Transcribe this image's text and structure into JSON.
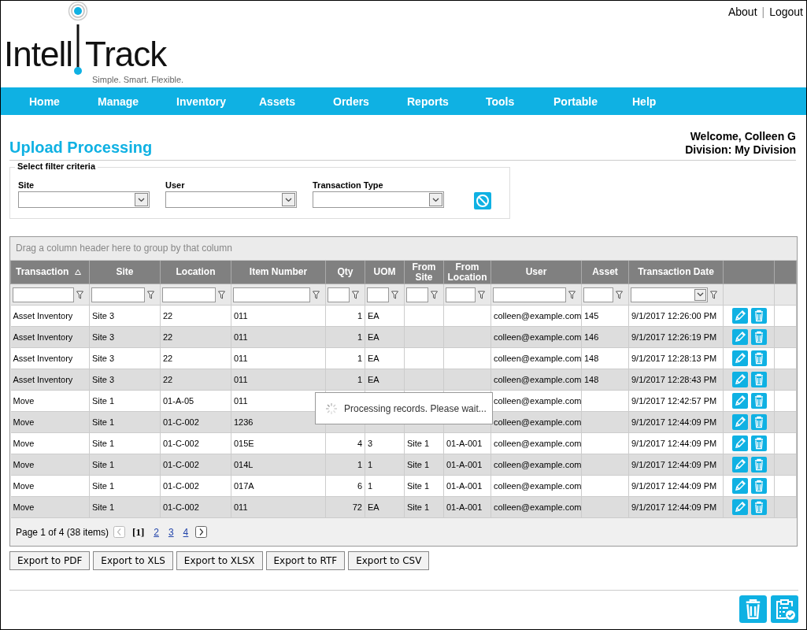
{
  "header_links": [
    "About",
    "Logout"
  ],
  "link_separator": "|",
  "logo": {
    "text_left": "Intell",
    "text_right": "Track",
    "tagline": "Simple. Smart. Flexible."
  },
  "nav": [
    "Home",
    "Manage",
    "Inventory",
    "Assets",
    "Orders",
    "Reports",
    "Tools",
    "Portable",
    "Help"
  ],
  "page_title": "Upload Processing",
  "welcome": "Welcome, Colleen G",
  "division": "Division: My Division",
  "filters": {
    "legend": "Select filter criteria",
    "fields": [
      {
        "label": "Site"
      },
      {
        "label": "User"
      },
      {
        "label": "Transaction Type"
      }
    ]
  },
  "grid": {
    "group_hint": "Drag a column header here to group by that column",
    "columns": [
      {
        "label": "Transaction",
        "sorted": true,
        "kind": "text"
      },
      {
        "label": "Site",
        "sorted": false,
        "kind": "text"
      },
      {
        "label": "Location",
        "sorted": false,
        "kind": "text"
      },
      {
        "label": "Item Number",
        "sorted": false,
        "kind": "text"
      },
      {
        "label": "Qty",
        "sorted": false,
        "kind": "text"
      },
      {
        "label": "UOM",
        "sorted": false,
        "kind": "text"
      },
      {
        "label": "From Site",
        "sorted": false,
        "kind": "text"
      },
      {
        "label": "From Location",
        "sorted": false,
        "kind": "text"
      },
      {
        "label": "User",
        "sorted": false,
        "kind": "text"
      },
      {
        "label": "Asset",
        "sorted": false,
        "kind": "text"
      },
      {
        "label": "Transaction Date",
        "sorted": false,
        "kind": "dropdown"
      }
    ],
    "rows": [
      {
        "cells": [
          "Asset Inventory",
          "Site 3",
          "22",
          "011",
          "1",
          "EA",
          null,
          null,
          "colleen@example.com",
          "145",
          "9/1/2017 12:26:00 PM"
        ]
      },
      {
        "cells": [
          "Asset Inventory",
          "Site 3",
          "22",
          "011",
          "1",
          "EA",
          null,
          null,
          "colleen@example.com",
          "146",
          "9/1/2017 12:26:19 PM"
        ]
      },
      {
        "cells": [
          "Asset Inventory",
          "Site 3",
          "22",
          "011",
          "1",
          "EA",
          null,
          null,
          "colleen@example.com",
          "148",
          "9/1/2017 12:28:13 PM"
        ]
      },
      {
        "cells": [
          "Asset Inventory",
          "Site 3",
          "22",
          "011",
          "1",
          "EA",
          null,
          null,
          "colleen@example.com",
          "148",
          "9/1/2017 12:28:43 PM"
        ]
      },
      {
        "cells": [
          "Move",
          "Site 1",
          "01-A-05",
          "011",
          null,
          null,
          null,
          null,
          "colleen@example.com",
          null,
          "9/1/2017 12:42:57 PM"
        ]
      },
      {
        "cells": [
          "Move",
          "Site 1",
          "01-C-002",
          "1236",
          null,
          null,
          null,
          null,
          "colleen@example.com",
          null,
          "9/1/2017 12:44:09 PM"
        ]
      },
      {
        "cells": [
          "Move",
          "Site 1",
          "01-C-002",
          "015E",
          "4",
          "3",
          "Site 1",
          "01-A-001",
          "colleen@example.com",
          null,
          "9/1/2017 12:44:09 PM"
        ]
      },
      {
        "cells": [
          "Move",
          "Site 1",
          "01-C-002",
          "014L",
          "1",
          "1",
          "Site 1",
          "01-A-001",
          "colleen@example.com",
          null,
          "9/1/2017 12:44:09 PM"
        ]
      },
      {
        "cells": [
          "Move",
          "Site 1",
          "01-C-002",
          "017A",
          "6",
          "1",
          "Site 1",
          "01-A-001",
          "colleen@example.com",
          null,
          "9/1/2017 12:44:09 PM"
        ]
      },
      {
        "cells": [
          "Move",
          "Site 1",
          "01-C-002",
          "011",
          "72",
          "EA",
          "Site 1",
          "01-A-001",
          "colleen@example.com",
          null,
          "9/1/2017 12:44:09 PM"
        ]
      }
    ],
    "pager": {
      "summary": "Page 1 of 4 (38 items)",
      "prev_disabled": true,
      "pages": [
        {
          "label": "[1]",
          "selected": true
        },
        {
          "label": "2",
          "selected": false
        },
        {
          "label": "3",
          "selected": false
        },
        {
          "label": "4",
          "selected": false
        }
      ]
    },
    "loading": "Processing records. Please wait..."
  },
  "exports": [
    "Export to PDF",
    "Export to XLS",
    "Export to XLSX",
    "Export to RTF",
    "Export to CSV"
  ]
}
